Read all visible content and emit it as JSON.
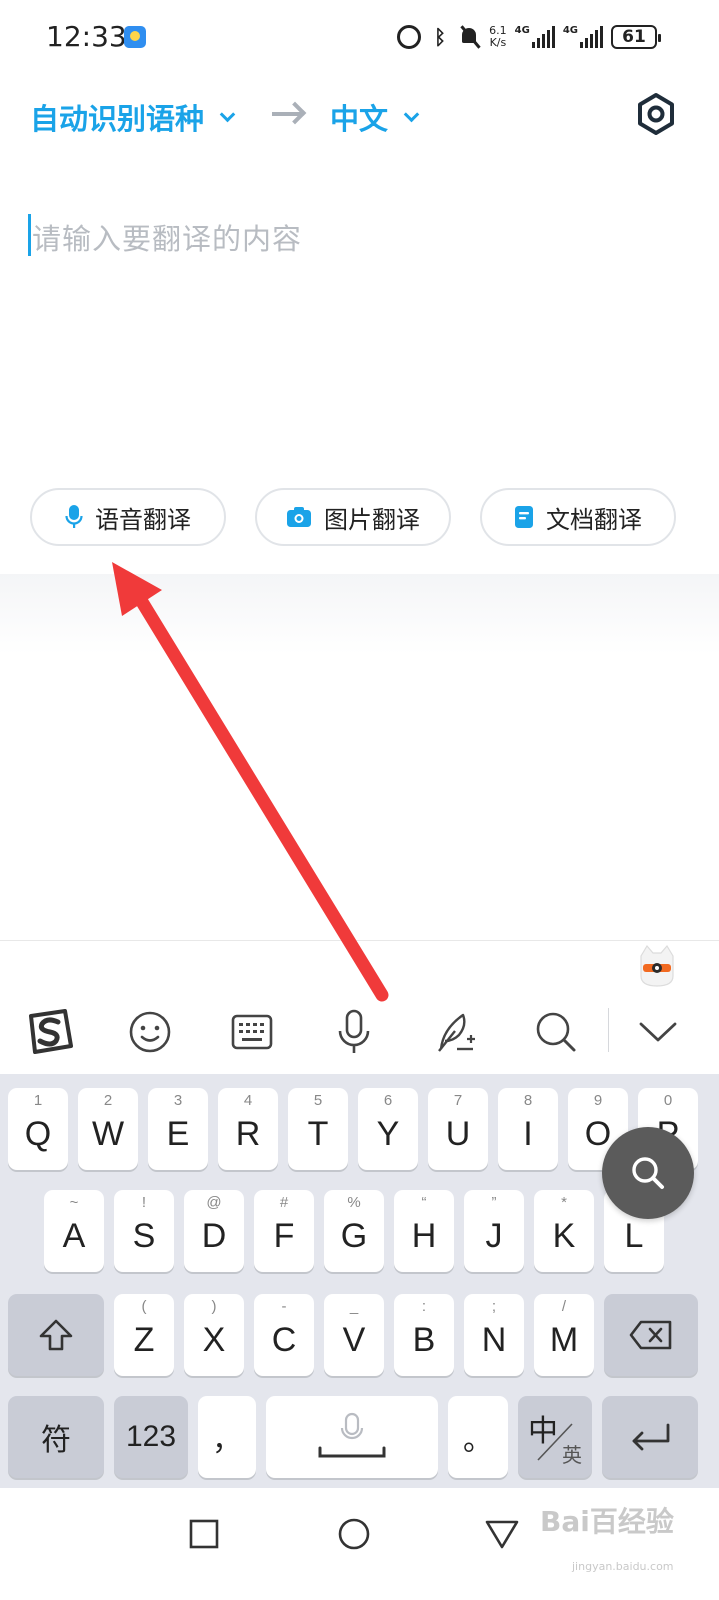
{
  "status_bar": {
    "time": "12:33",
    "net_speed_value": "6.1",
    "net_speed_unit": "K/s",
    "net_type_1": "4G",
    "net_type_2": "4G",
    "battery": "61"
  },
  "header": {
    "source_language": "自动识别语种",
    "target_language": "中文"
  },
  "input": {
    "placeholder": "请输入要翻译的内容"
  },
  "modes": {
    "voice": "语音翻译",
    "image": "图片翻译",
    "document": "文档翻译"
  },
  "keyboard": {
    "row1": [
      {
        "hint": "1",
        "key": "Q"
      },
      {
        "hint": "2",
        "key": "W"
      },
      {
        "hint": "3",
        "key": "E"
      },
      {
        "hint": "4",
        "key": "R"
      },
      {
        "hint": "5",
        "key": "T"
      },
      {
        "hint": "6",
        "key": "Y"
      },
      {
        "hint": "7",
        "key": "U"
      },
      {
        "hint": "8",
        "key": "I"
      },
      {
        "hint": "9",
        "key": "O"
      },
      {
        "hint": "0",
        "key": "P"
      }
    ],
    "row2": [
      {
        "hint": "~",
        "key": "A"
      },
      {
        "hint": "!",
        "key": "S"
      },
      {
        "hint": "@",
        "key": "D"
      },
      {
        "hint": "#",
        "key": "F"
      },
      {
        "hint": "%",
        "key": "G"
      },
      {
        "hint": "“",
        "key": "H"
      },
      {
        "hint": "”",
        "key": "J"
      },
      {
        "hint": "*",
        "key": "K"
      },
      {
        "hint": "?",
        "key": "L"
      }
    ],
    "row3": [
      {
        "hint": "(",
        "key": "Z"
      },
      {
        "hint": ")",
        "key": "X"
      },
      {
        "hint": "-",
        "key": "C"
      },
      {
        "hint": "_",
        "key": "V"
      },
      {
        "hint": ":",
        "key": "B"
      },
      {
        "hint": ";",
        "key": "N"
      },
      {
        "hint": "/",
        "key": "M"
      }
    ],
    "symbols_key": "符",
    "numbers_key": "123",
    "comma_key": "，",
    "period_key": "。",
    "lang_switch_main": "中",
    "lang_switch_sub": "英"
  },
  "watermark": {
    "brand": "Bai百经验",
    "url": "jingyan.baidu.com"
  },
  "colors": {
    "accent": "#1aa3e8",
    "annotation": "#f03a3a",
    "keyboard_bg": "#e4e6ed"
  }
}
